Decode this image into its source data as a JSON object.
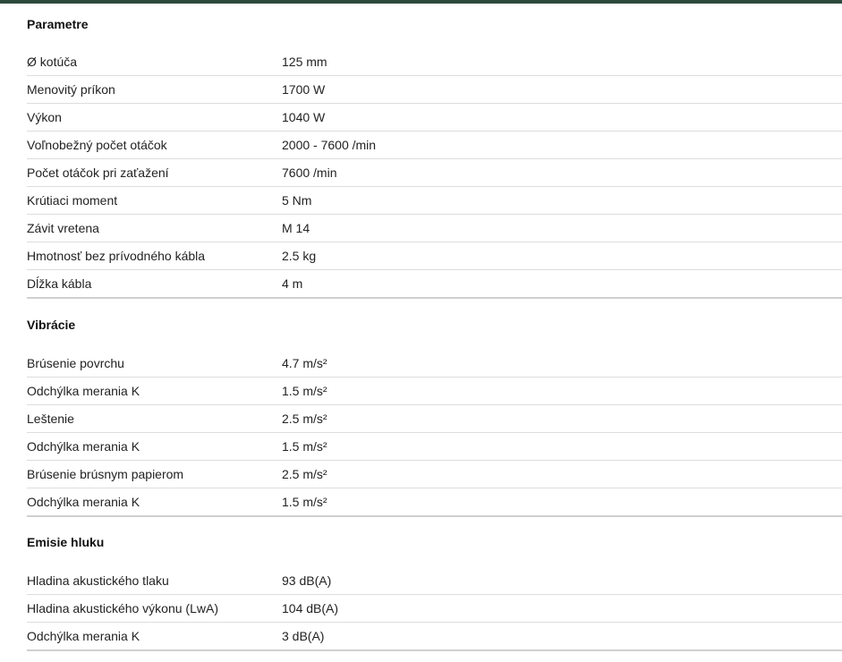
{
  "sections": [
    {
      "title": "Parametre",
      "rows": [
        {
          "label": "Ø kotúča",
          "value": "125 mm"
        },
        {
          "label": "Menovitý príkon",
          "value": "1700 W"
        },
        {
          "label": "Výkon",
          "value": "1040 W"
        },
        {
          "label": "Voľnobežný počet otáčok",
          "value": "2000 - 7600 /min"
        },
        {
          "label": "Počet otáčok pri zaťažení",
          "value": "7600 /min"
        },
        {
          "label": "Krútiaci moment",
          "value": "5 Nm"
        },
        {
          "label": "Závit vretena",
          "value": "M 14"
        },
        {
          "label": "Hmotnosť bez prívodného kábla",
          "value": "2.5 kg"
        },
        {
          "label": "Dĺžka kábla",
          "value": "4 m"
        }
      ]
    },
    {
      "title": "Vibrácie",
      "rows": [
        {
          "label": "Brúsenie povrchu",
          "value": "4.7 m/s²"
        },
        {
          "label": "Odchýlka merania K",
          "value": "1.5 m/s²"
        },
        {
          "label": "Leštenie",
          "value": "2.5 m/s²"
        },
        {
          "label": "Odchýlka merania K",
          "value": "1.5 m/s²"
        },
        {
          "label": "Brúsenie brúsnym papierom",
          "value": "2.5 m/s²"
        },
        {
          "label": "Odchýlka merania K",
          "value": "1.5 m/s²"
        }
      ]
    },
    {
      "title": "Emisie hluku",
      "rows": [
        {
          "label": "Hladina akustického tlaku",
          "value": "93 dB(A)"
        },
        {
          "label": "Hladina akustického výkonu (LwA)",
          "value": "104 dB(A)"
        },
        {
          "label": "Odchýlka merania K",
          "value": "3 dB(A)"
        }
      ]
    }
  ]
}
